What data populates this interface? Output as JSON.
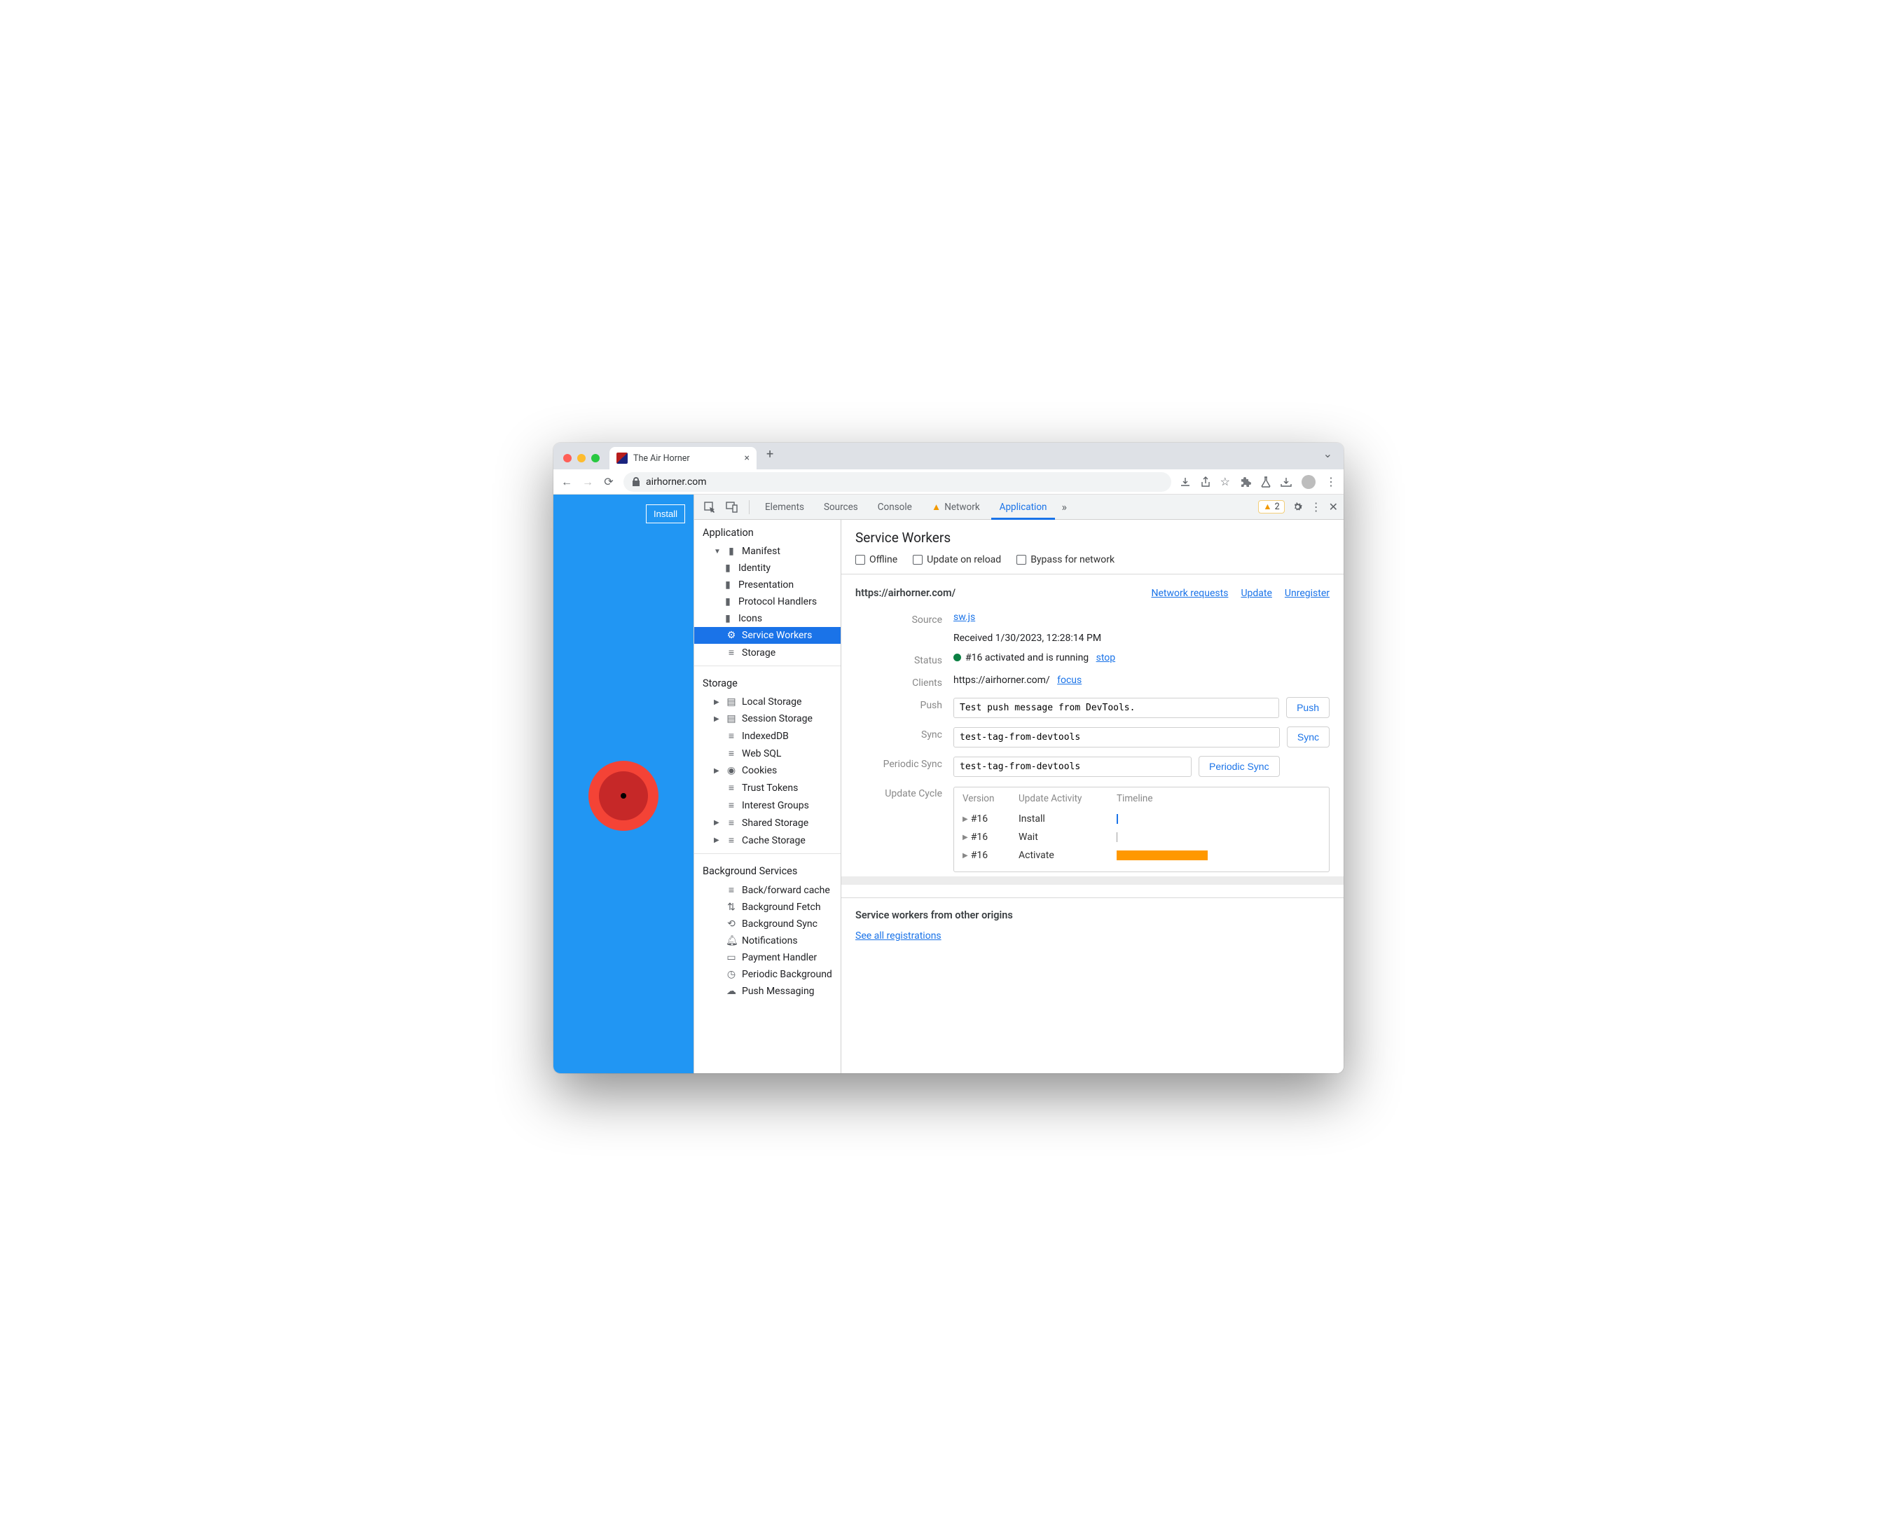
{
  "browser": {
    "tab_title": "The Air Horner",
    "url": "airhorner.com"
  },
  "page": {
    "install_label": "Install"
  },
  "devtools": {
    "tabs": {
      "elements": "Elements",
      "sources": "Sources",
      "console": "Console",
      "network": "Network",
      "application": "Application"
    },
    "warning_count": "2"
  },
  "sidebar": {
    "sections": {
      "application": "Application",
      "storage": "Storage",
      "background": "Background Services"
    },
    "app_items": {
      "manifest": "Manifest",
      "identity": "Identity",
      "presentation": "Presentation",
      "protocol": "Protocol Handlers",
      "icons": "Icons",
      "service_workers": "Service Workers",
      "storage": "Storage"
    },
    "storage_items": {
      "local": "Local Storage",
      "session": "Session Storage",
      "indexed": "IndexedDB",
      "websql": "Web SQL",
      "cookies": "Cookies",
      "trust": "Trust Tokens",
      "interest": "Interest Groups",
      "shared": "Shared Storage",
      "cache": "Cache Storage"
    },
    "bg_items": {
      "bfcache": "Back/forward cache",
      "fetch": "Background Fetch",
      "sync": "Background Sync",
      "notif": "Notifications",
      "payment": "Payment Handler",
      "periodic": "Periodic Background",
      "push": "Push Messaging"
    }
  },
  "panel": {
    "title": "Service Workers",
    "checks": {
      "offline": "Offline",
      "update": "Update on reload",
      "bypass": "Bypass for network"
    },
    "scope_url": "https://airhorner.com/",
    "links": {
      "network": "Network requests",
      "update": "Update",
      "unregister": "Unregister"
    },
    "labels": {
      "source": "Source",
      "status": "Status",
      "clients": "Clients",
      "push": "Push",
      "sync": "Sync",
      "periodic": "Periodic Sync",
      "cycle": "Update Cycle"
    },
    "source": {
      "file": "sw.js",
      "received": "Received 1/30/2023, 12:28:14 PM"
    },
    "status": {
      "text": "#16 activated and is running",
      "stop": "stop"
    },
    "clients": {
      "url": "https://airhorner.com/",
      "focus": "focus"
    },
    "push": {
      "value": "Test push message from DevTools.",
      "btn": "Push"
    },
    "sync": {
      "value": "test-tag-from-devtools",
      "btn": "Sync"
    },
    "periodic": {
      "value": "test-tag-from-devtools",
      "btn": "Periodic Sync"
    },
    "cycle": {
      "headers": {
        "version": "Version",
        "activity": "Update Activity",
        "timeline": "Timeline"
      },
      "rows": [
        {
          "v": "#16",
          "a": "Install"
        },
        {
          "v": "#16",
          "a": "Wait"
        },
        {
          "v": "#16",
          "a": "Activate"
        }
      ]
    },
    "other": {
      "title": "Service workers from other origins",
      "link": "See all registrations"
    }
  }
}
